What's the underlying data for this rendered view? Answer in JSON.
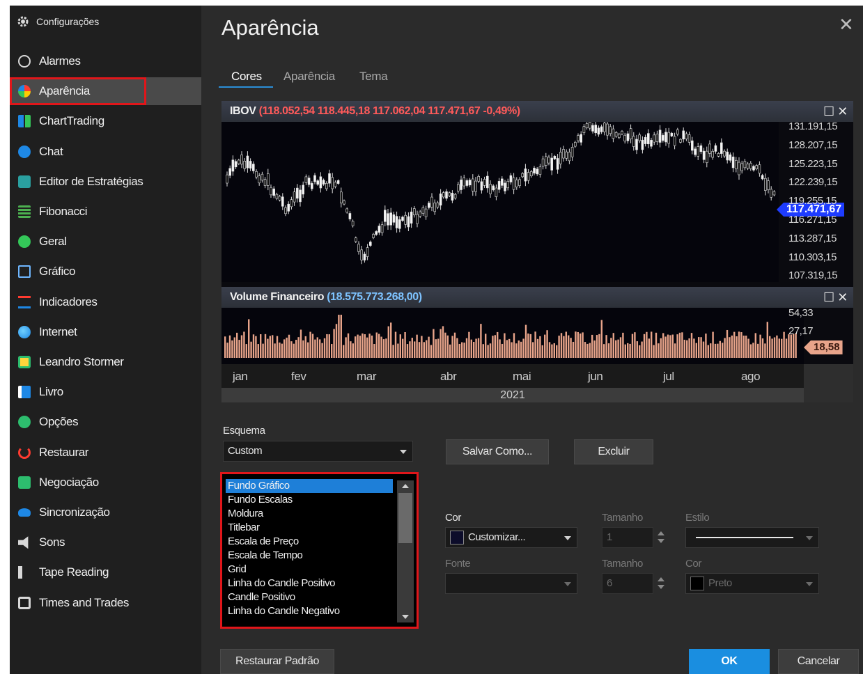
{
  "sidebar": {
    "title": "Configurações",
    "items": [
      {
        "label": "Alarmes",
        "icon": "alarm-icon",
        "active": false
      },
      {
        "label": "Aparência",
        "icon": "palette-icon",
        "active": true
      },
      {
        "label": "ChartTrading",
        "icon": "chart-trading-icon",
        "active": false
      },
      {
        "label": "Chat",
        "icon": "chat-icon",
        "active": false
      },
      {
        "label": "Editor de Estratégias",
        "icon": "strategy-editor-icon",
        "active": false
      },
      {
        "label": "Fibonacci",
        "icon": "fibonacci-icon",
        "active": false
      },
      {
        "label": "Geral",
        "icon": "check-icon",
        "active": false
      },
      {
        "label": "Gráfico",
        "icon": "chart-icon",
        "active": false
      },
      {
        "label": "Indicadores",
        "icon": "indicators-icon",
        "active": false
      },
      {
        "label": "Internet",
        "icon": "globe-icon",
        "active": false
      },
      {
        "label": "Leandro Stormer",
        "icon": "leandro-stormer-icon",
        "active": false
      },
      {
        "label": "Livro",
        "icon": "book-icon",
        "active": false
      },
      {
        "label": "Opções",
        "icon": "options-icon",
        "active": false
      },
      {
        "label": "Restaurar",
        "icon": "restore-icon",
        "active": false
      },
      {
        "label": "Negociação",
        "icon": "trading-icon",
        "active": false
      },
      {
        "label": "Sincronização",
        "icon": "cloud-icon",
        "active": false
      },
      {
        "label": "Sons",
        "icon": "speaker-icon",
        "active": false
      },
      {
        "label": "Tape Reading",
        "icon": "tape-reading-icon",
        "active": false
      },
      {
        "label": "Times and Trades",
        "icon": "times-trades-icon",
        "active": false
      }
    ]
  },
  "header": {
    "title": "Aparência",
    "close": "✕"
  },
  "tabs": [
    {
      "label": "Cores",
      "selected": true
    },
    {
      "label": "Aparência",
      "selected": false
    },
    {
      "label": "Tema",
      "selected": false
    }
  ],
  "preview": {
    "price_pane": {
      "symbol": "IBOV",
      "values": "(118.052,54  118.445,18  117.062,04  117.471,67  -0,49%)",
      "axis_labels": [
        "131.191,15",
        "128.207,15",
        "125.223,15",
        "122.239,15",
        "119.255,15",
        "116.271,15",
        "113.287,15",
        "110.303,15",
        "107.319,15"
      ],
      "last_price": "117.471,67"
    },
    "volume_pane": {
      "title": "Volume Financeiro",
      "value": "(18.575.773.268,00)",
      "axis_labels": [
        "54,33",
        "27,17"
      ],
      "last_value": "18,58"
    },
    "months": [
      "jan",
      "fev",
      "mar",
      "abr",
      "mai",
      "jun",
      "jul",
      "ago"
    ],
    "year": "2021",
    "pane_buttons": "☐ ✕"
  },
  "scheme": {
    "label": "Esquema",
    "value": "Custom",
    "save_as": "Salvar Como...",
    "delete": "Excluir"
  },
  "elements": {
    "items": [
      "Fundo Gráfico",
      "Fundo Escalas",
      "Moldura",
      "Titlebar",
      "Escala de Preço",
      "Escala de Tempo",
      "Grid",
      "Linha do Candle Positivo",
      "Candle Positivo",
      "Linha do Candle Negativo"
    ],
    "selected": 0
  },
  "style": {
    "cor_label": "Cor",
    "cor_value": "Customizar...",
    "tamanho_label": "Tamanho",
    "tamanho_value": "1",
    "estilo_label": "Estilo",
    "fonte_label": "Fonte",
    "fonte_value": "",
    "tamanho2_label": "Tamanho",
    "tamanho2_value": "6",
    "cor2_label": "Cor",
    "cor2_value": "Preto"
  },
  "footer": {
    "restore": "Restaurar Padrão",
    "ok": "OK",
    "cancel": "Cancelar"
  },
  "colors": {
    "accent": "#1a8ee0",
    "highlight": "#e0161a",
    "up": "#ff5a5a",
    "volume": "#e8a48a"
  }
}
